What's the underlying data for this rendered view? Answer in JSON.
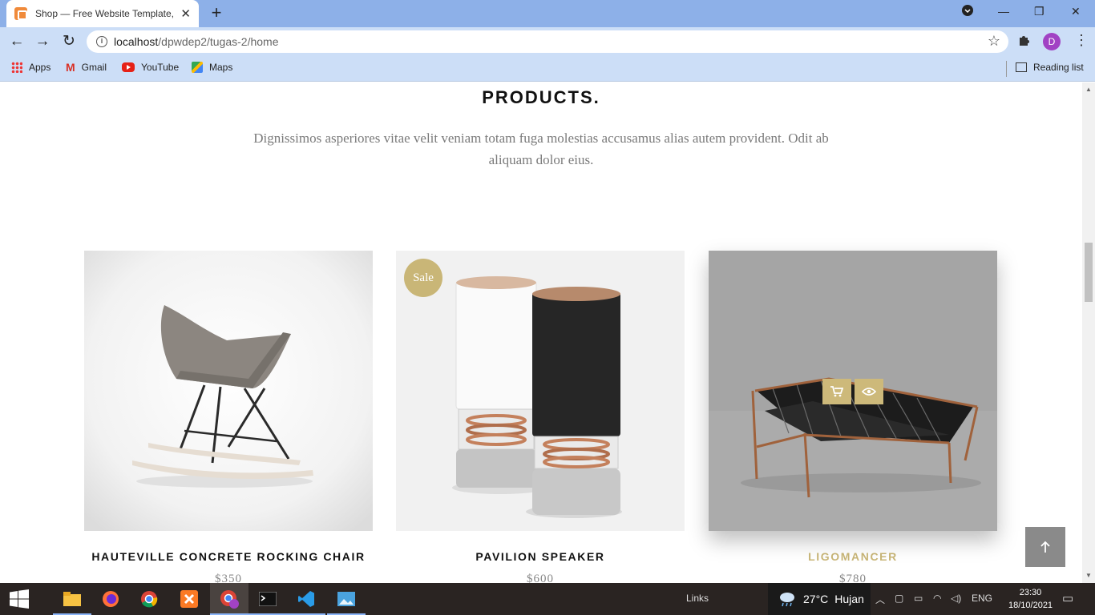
{
  "browser": {
    "tab_title": "Shop — Free Website Template, Free...",
    "url_host": "localhost",
    "url_path": "/dpwdep2/tugas-2/home",
    "profile_initial": "D",
    "bookmarks": [
      {
        "label": "Apps",
        "icon": "apps-icon"
      },
      {
        "label": "Gmail",
        "icon": "gmail-icon"
      },
      {
        "label": "YouTube",
        "icon": "youtube-icon"
      },
      {
        "label": "Maps",
        "icon": "maps-icon"
      }
    ],
    "reading_list": "Reading list"
  },
  "section": {
    "title": "PRODUCTS.",
    "description": "Dignissimos asperiores vitae velit veniam totam fuga molestias accusamus alias autem provident. Odit ab aliquam dolor eius."
  },
  "products": [
    {
      "name": "HAUTEVILLE CONCRETE ROCKING CHAIR",
      "price": "$350",
      "badge": null
    },
    {
      "name": "PAVILION SPEAKER",
      "price": "$600",
      "badge": "Sale"
    },
    {
      "name": "LIGOMANCER",
      "price": "$780",
      "badge": null
    }
  ],
  "colors": {
    "accent": "#c9b677",
    "title": "#111111",
    "muted": "#7a7a7a"
  },
  "taskbar": {
    "links_label": "Links",
    "weather_temp": "27°C",
    "weather_desc": "Hujan",
    "language": "ENG",
    "time": "23:30",
    "date": "18/10/2021"
  }
}
